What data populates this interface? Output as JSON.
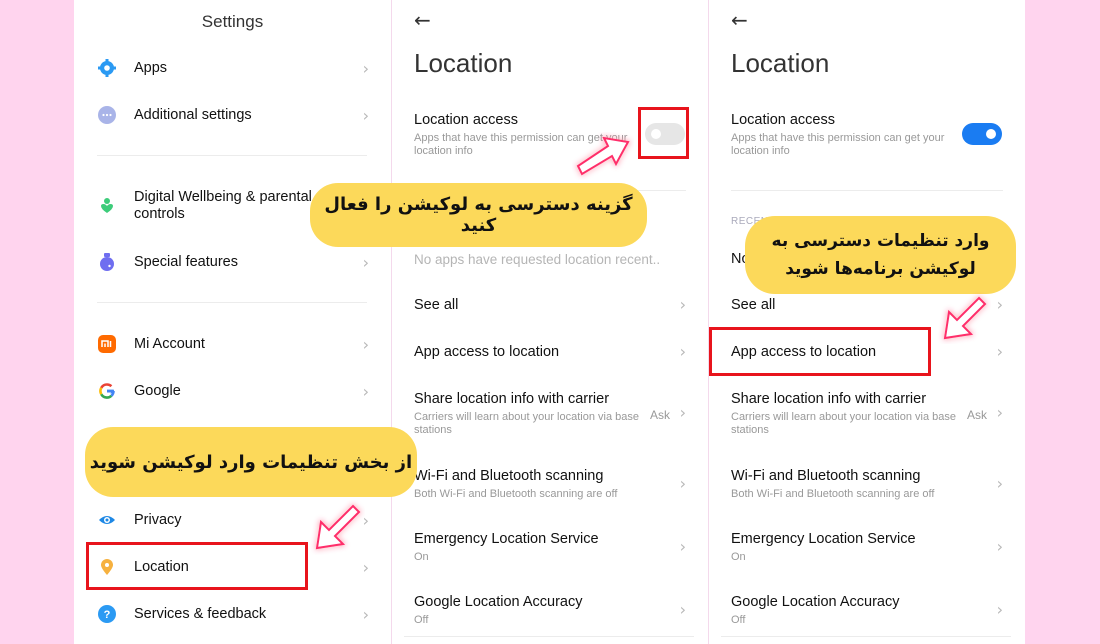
{
  "settings_panel": {
    "title": "Settings",
    "items": [
      {
        "label": "Apps",
        "icon": "gear-icon",
        "color": "#2b9af3"
      },
      {
        "label": "Additional settings",
        "icon": "more-dots-icon",
        "color": "#a9b4e8"
      },
      {
        "label": "Digital Wellbeing & parental controls",
        "label_line1": "Digital Wellbeing & parental",
        "label_line2": "controls",
        "icon": "wellbeing-icon",
        "color": "#3dcc7a"
      },
      {
        "label": "Special features",
        "icon": "flask-icon",
        "color": "#6f6ef0"
      },
      {
        "label": "Mi Account",
        "icon": "mi-logo-icon",
        "color": "#ff6a00"
      },
      {
        "label": "Google",
        "icon": "google-logo-icon",
        "color": "#4285f4"
      },
      {
        "label": "Privacy",
        "icon": "eye-icon",
        "color": "#1e88e5"
      },
      {
        "label": "Location",
        "icon": "location-pin-icon",
        "color": "#f6b13f"
      },
      {
        "label": "Services & feedback",
        "icon": "help-icon",
        "color": "#2b9af3"
      }
    ]
  },
  "location_panel_off": {
    "back": "←",
    "title": "Location",
    "access_title": "Location access",
    "access_sub": "Apps that have this permission can get your location info",
    "access_enabled": false,
    "recent_empty": "No apps have requested location recent..",
    "items": [
      {
        "title": "See all"
      },
      {
        "title": "App access to location"
      },
      {
        "title": "Share location info with carrier",
        "sub": "Carriers will learn about your location via base stations",
        "value": "Ask"
      },
      {
        "title": "Wi-Fi and Bluetooth scanning",
        "sub": "Both Wi-Fi and Bluetooth scanning are off"
      },
      {
        "title": "Emergency Location Service",
        "sub": "On"
      },
      {
        "title": "Google Location Accuracy",
        "sub": "Off"
      }
    ]
  },
  "location_panel_on": {
    "back": "←",
    "title": "Location",
    "access_title": "Location access",
    "access_sub": "Apps that have this permission can get your location info",
    "access_enabled": true,
    "recent_header": "RECENT",
    "recent_partial": "No",
    "items": [
      {
        "title": "See all"
      },
      {
        "title": "App access to location"
      },
      {
        "title": "Share location info with carrier",
        "sub": "Carriers will learn about your location via base stations",
        "value": "Ask"
      },
      {
        "title": "Wi-Fi and Bluetooth scanning",
        "sub": "Both Wi-Fi and Bluetooth scanning are off"
      },
      {
        "title": "Emergency Location Service",
        "sub": "On"
      },
      {
        "title": "Google Location Accuracy",
        "sub": "Off"
      }
    ]
  },
  "annotations": {
    "step1": "از بخش تنظیمات وارد لوکیشن شوید",
    "step2": "گزینه دسترسی به لوکیشن را فعال کنید",
    "step3_line1": "وارد تنظیمات دسترسی به",
    "step3_line2": "لوکیشن برنامه‌ها شوید",
    "highlight_color": "#e8141c",
    "bubble_color": "#fcd95a"
  },
  "chevron": "›"
}
